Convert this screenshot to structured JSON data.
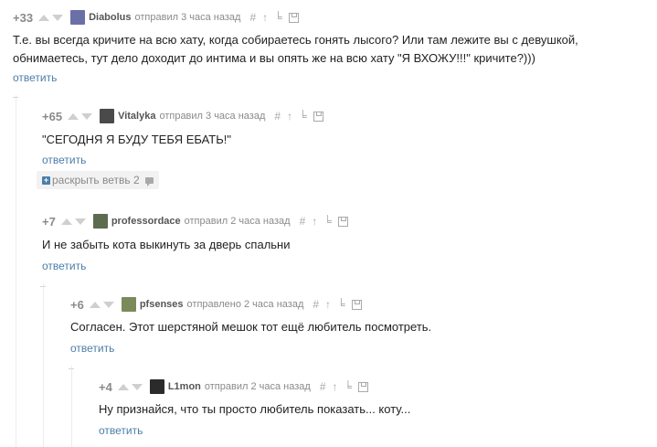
{
  "colors": {
    "rating": "#8a8a8a",
    "link": "#4b7ea8",
    "meta": "#8a8a8a",
    "text": "#222222",
    "vote_arrow": "#cfcfcf"
  },
  "tools_icons": [
    "hash-icon",
    "up-arrow-icon",
    "parent-icon",
    "save-icon"
  ],
  "tools_glyphs": [
    "#",
    "↑",
    "╘",
    ""
  ],
  "comments": [
    {
      "rating": "+33",
      "username": "Diabolus",
      "meta": "отправил 3 часа назад",
      "text_lines": [
        "Т.е. вы всегда кричите на всю хату, когда собираетесь гонять лысого? Или там лежите вы с девушкой,",
        "обнимаетесь, тут дело доходит до интима и вы опять же на всю хату \"Я ВХОЖУ!!!\" кричите?)))"
      ],
      "reply_label": "ответить",
      "avatar_color": "#6a6fa8"
    },
    {
      "rating": "+65",
      "username": "Vitalyka",
      "meta": "отправил 3 часа назад",
      "text_lines": [
        "\"СЕГОДНЯ Я БУДУ ТЕБЯ ЕБАТЬ!\""
      ],
      "reply_label": "ответить",
      "expand_label": "раскрыть ветвь 2",
      "avatar_color": "#4a4a4a"
    },
    {
      "rating": "+7",
      "username": "professordace",
      "meta": "отправил 2 часа назад",
      "text_lines": [
        "И не забыть кота выкинуть за дверь спальни"
      ],
      "reply_label": "ответить",
      "avatar_color": "#5d6b4f"
    },
    {
      "rating": "+6",
      "username": "pfsenses",
      "meta": "отправлено 2 часа назад",
      "text_lines": [
        "Согласен. Этот шерстяной мешок тот ещё любитель посмотреть."
      ],
      "reply_label": "ответить",
      "avatar_color": "#7a8a5a"
    },
    {
      "rating": "+4",
      "username": "L1mon",
      "meta": "отправил 2 часа назад",
      "text_lines": [
        "Ну признайся, что ты просто любитель показать... коту..."
      ],
      "reply_label": "ответить",
      "avatar_color": "#2b2b2b"
    }
  ]
}
